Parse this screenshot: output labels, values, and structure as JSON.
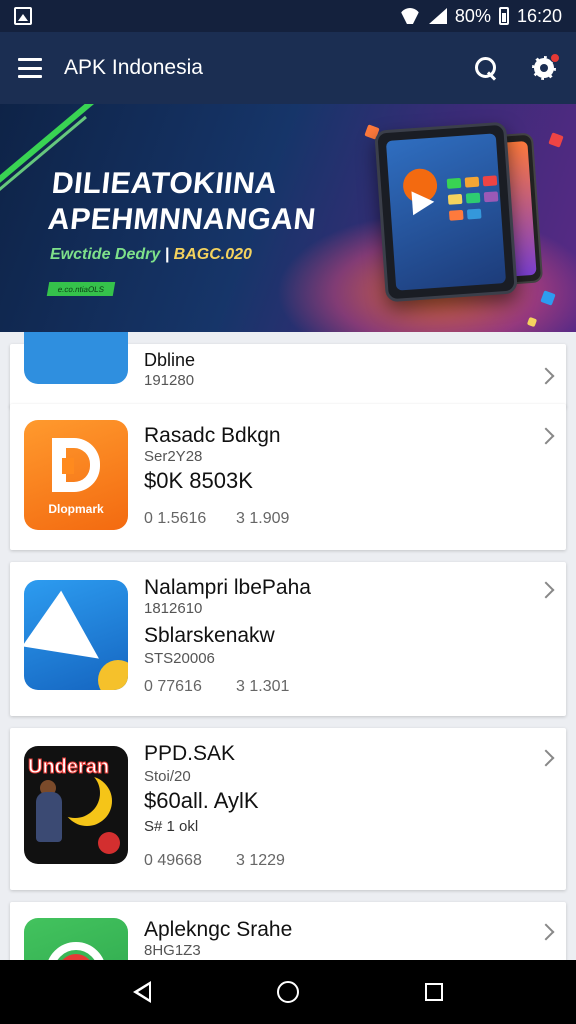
{
  "status_bar": {
    "battery_text": "80%",
    "time": "16:20"
  },
  "app_bar": {
    "title": "APK Indonesia"
  },
  "banner": {
    "headline_line1": "DILIEATOKIINA",
    "headline_line2": "APEHMNNANGAN",
    "sub_green": "Ewctide Dedry",
    "sub_sep": " | ",
    "sub_yellow": "BAGC.020",
    "cta": "e.co.ntiaOLS"
  },
  "apps": [
    {
      "name": "Dbline",
      "meta": "191280",
      "icon": "pattern-app-icon"
    },
    {
      "name": "Rasadc Bdkgn",
      "meta": "Ser2Y28",
      "price": "$0K 8503K",
      "icon_label": "Dlopmark",
      "stat1": "0 1.5616",
      "stat2": "3 1.909",
      "icon": "d-letter-icon"
    },
    {
      "name": "Nalampri lbePaha",
      "meta": "1812610",
      "price": "Sblarskenakw",
      "meta2": "STS20006",
      "stat1": "0 77616",
      "stat2": "3 1.301",
      "icon": "arrow-icon"
    },
    {
      "name": "PPD.SAK",
      "meta": "Stoi/20",
      "price": "$60all. AylK",
      "meta2": "S# 1 okl",
      "icon_label": "Underan",
      "stat1": "0 49668",
      "stat2": "3 1229",
      "icon": "game-icon"
    },
    {
      "name": "Aplekngc Srahe",
      "meta": "8HG1Z3",
      "icon": "green-app-icon"
    }
  ]
}
